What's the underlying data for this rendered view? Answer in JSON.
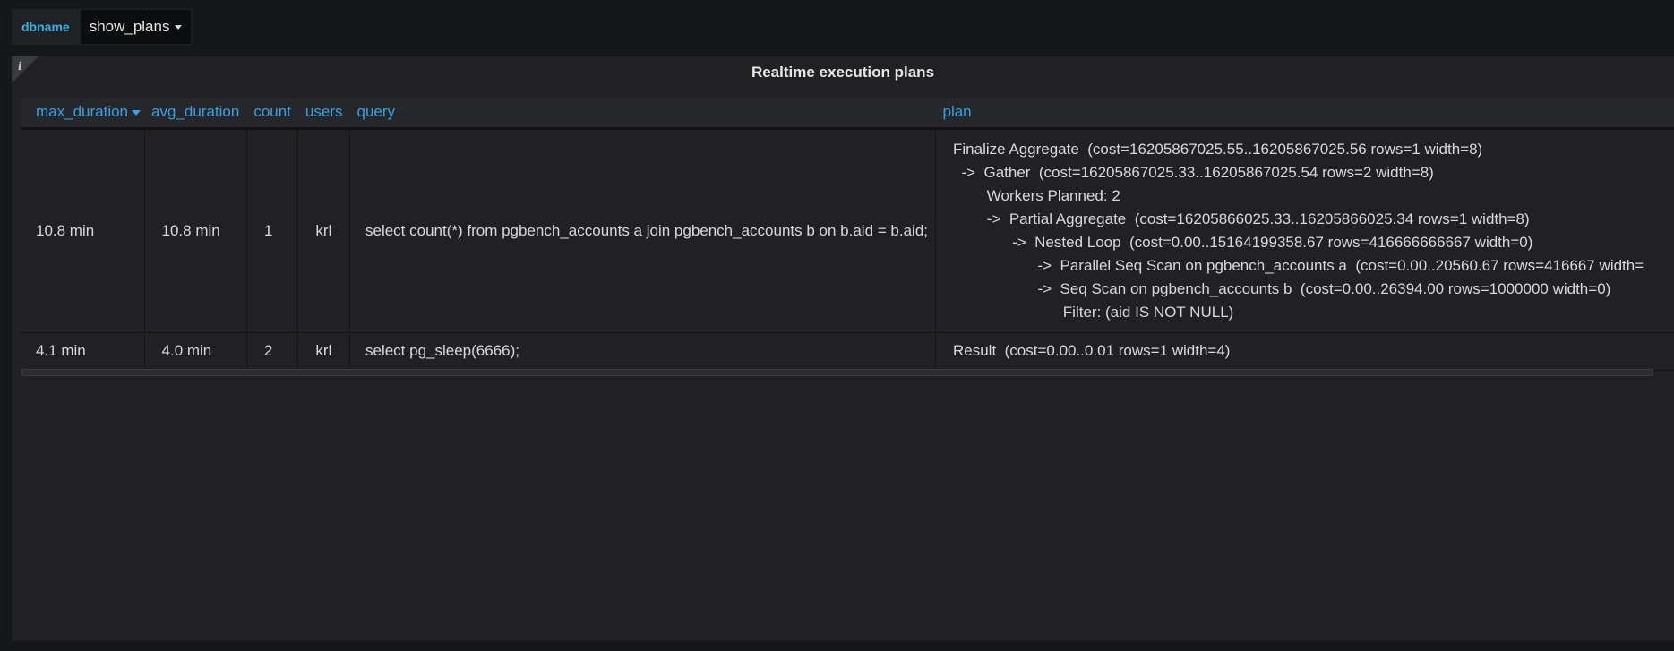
{
  "variables": {
    "label": "dbname",
    "value": "show_plans"
  },
  "panel": {
    "title": "Realtime execution plans",
    "info_icon": "i"
  },
  "table": {
    "columns": [
      "max_duration",
      "avg_duration",
      "count",
      "users",
      "query",
      "plan"
    ],
    "sorted_column": "max_duration",
    "sort_direction": "desc",
    "rows": [
      {
        "max_duration": "10.8 min",
        "avg_duration": "10.8 min",
        "count": "1",
        "users": "krl",
        "query": "select count(*) from pgbench_accounts a join pgbench_accounts b on b.aid = b.aid;",
        "plan": [
          "Finalize Aggregate  (cost=16205867025.55..16205867025.56 rows=1 width=8)",
          "  ->  Gather  (cost=16205867025.33..16205867025.54 rows=2 width=8)",
          "        Workers Planned: 2",
          "        ->  Partial Aggregate  (cost=16205866025.33..16205866025.34 rows=1 width=8)",
          "              ->  Nested Loop  (cost=0.00..15164199358.67 rows=416666666667 width=0)",
          "                    ->  Parallel Seq Scan on pgbench_accounts a  (cost=0.00..20560.67 rows=416667 width=",
          "                    ->  Seq Scan on pgbench_accounts b  (cost=0.00..26394.00 rows=1000000 width=0)",
          "                          Filter: (aid IS NOT NULL)"
        ]
      },
      {
        "max_duration": "4.1 min",
        "avg_duration": "4.0 min",
        "count": "2",
        "users": "krl",
        "query": "select pg_sleep(6666);",
        "plan": [
          "Result  (cost=0.00..0.01 rows=1 width=4)"
        ]
      }
    ]
  },
  "colors": {
    "background": "#161719",
    "panel": "#212124",
    "header_text": "#33a2e5",
    "variable_label": "#33b5e5"
  }
}
